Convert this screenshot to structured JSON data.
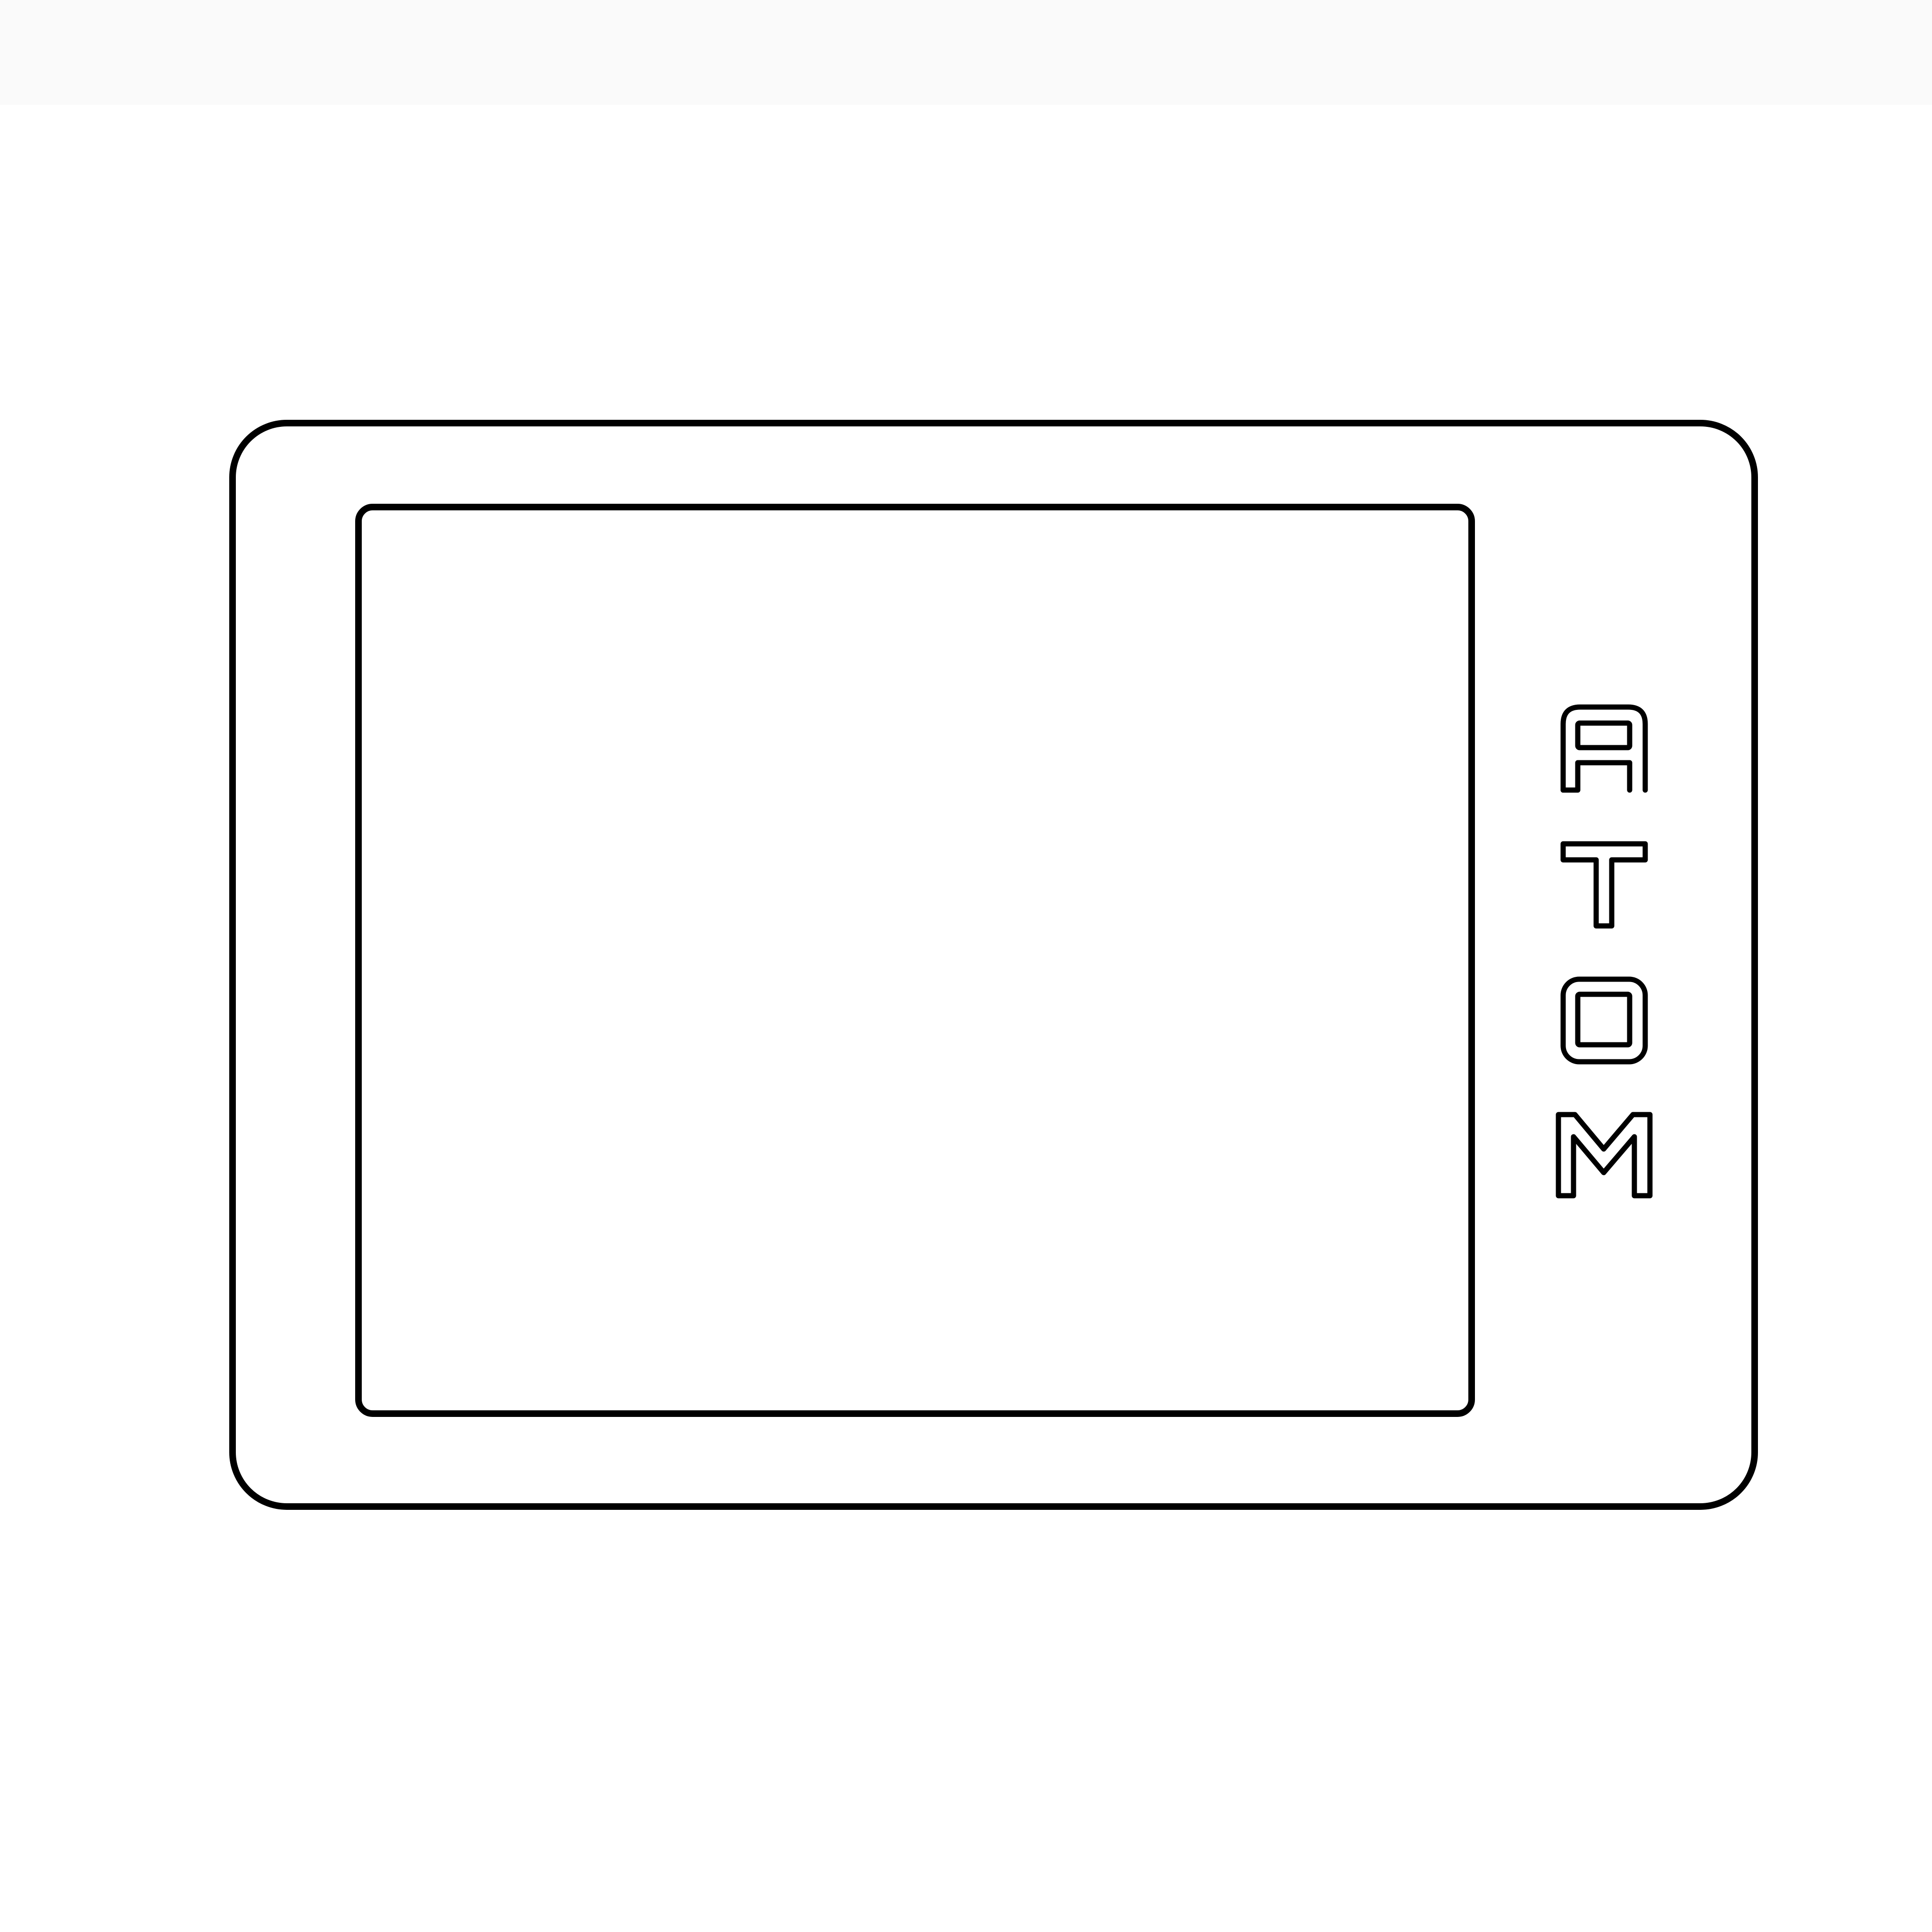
{
  "device": {
    "brand_logo": "ATOM",
    "outline_color": "#000000",
    "background_color": "#ffffff",
    "top_strip_color": "#fafafa"
  }
}
